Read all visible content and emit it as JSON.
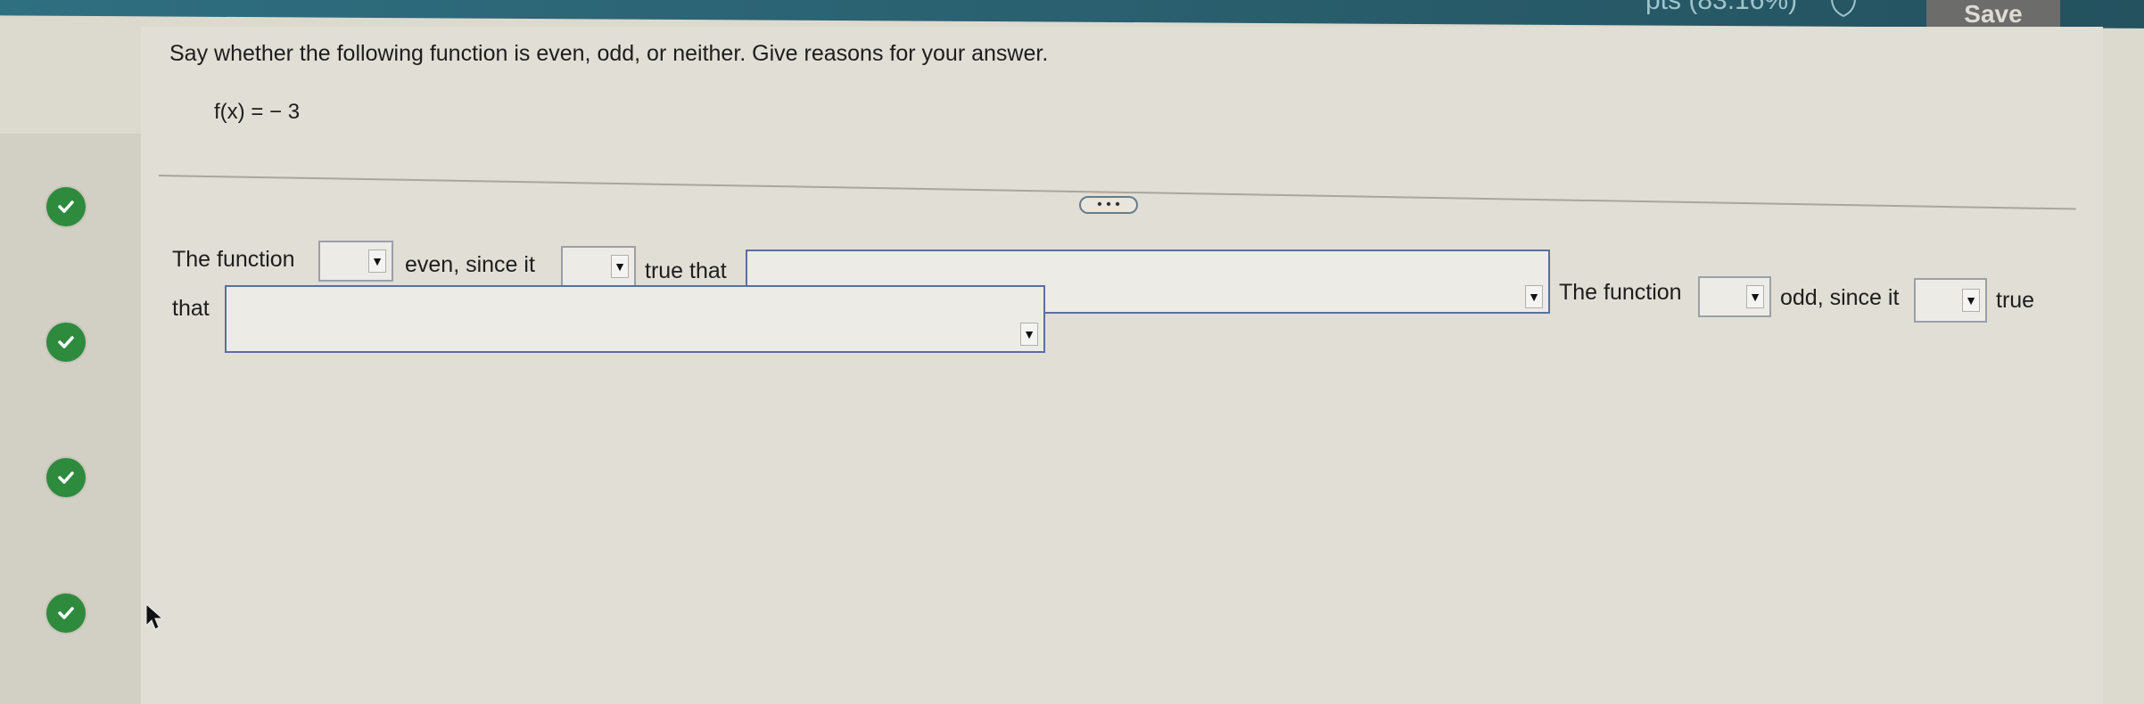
{
  "header": {
    "score_text": "pts (83.16%)",
    "save_label": "Save"
  },
  "question": {
    "prompt": "Say whether the following function is even, odd, or neither. Give reasons for your answer.",
    "function": "f(x) = − 3",
    "more_label": "• • •"
  },
  "answer": {
    "t1": "The function",
    "t2": "even, since it",
    "t3": "true that",
    "t4": "The function",
    "t5": "odd, since it",
    "t6": "true",
    "t7": "that",
    "dropdown_arrow": "▼"
  },
  "sidebar": {
    "status": [
      "correct",
      "correct",
      "correct",
      "correct"
    ]
  },
  "colors": {
    "accent": "#2e6f80",
    "check": "#2e8a3d"
  }
}
